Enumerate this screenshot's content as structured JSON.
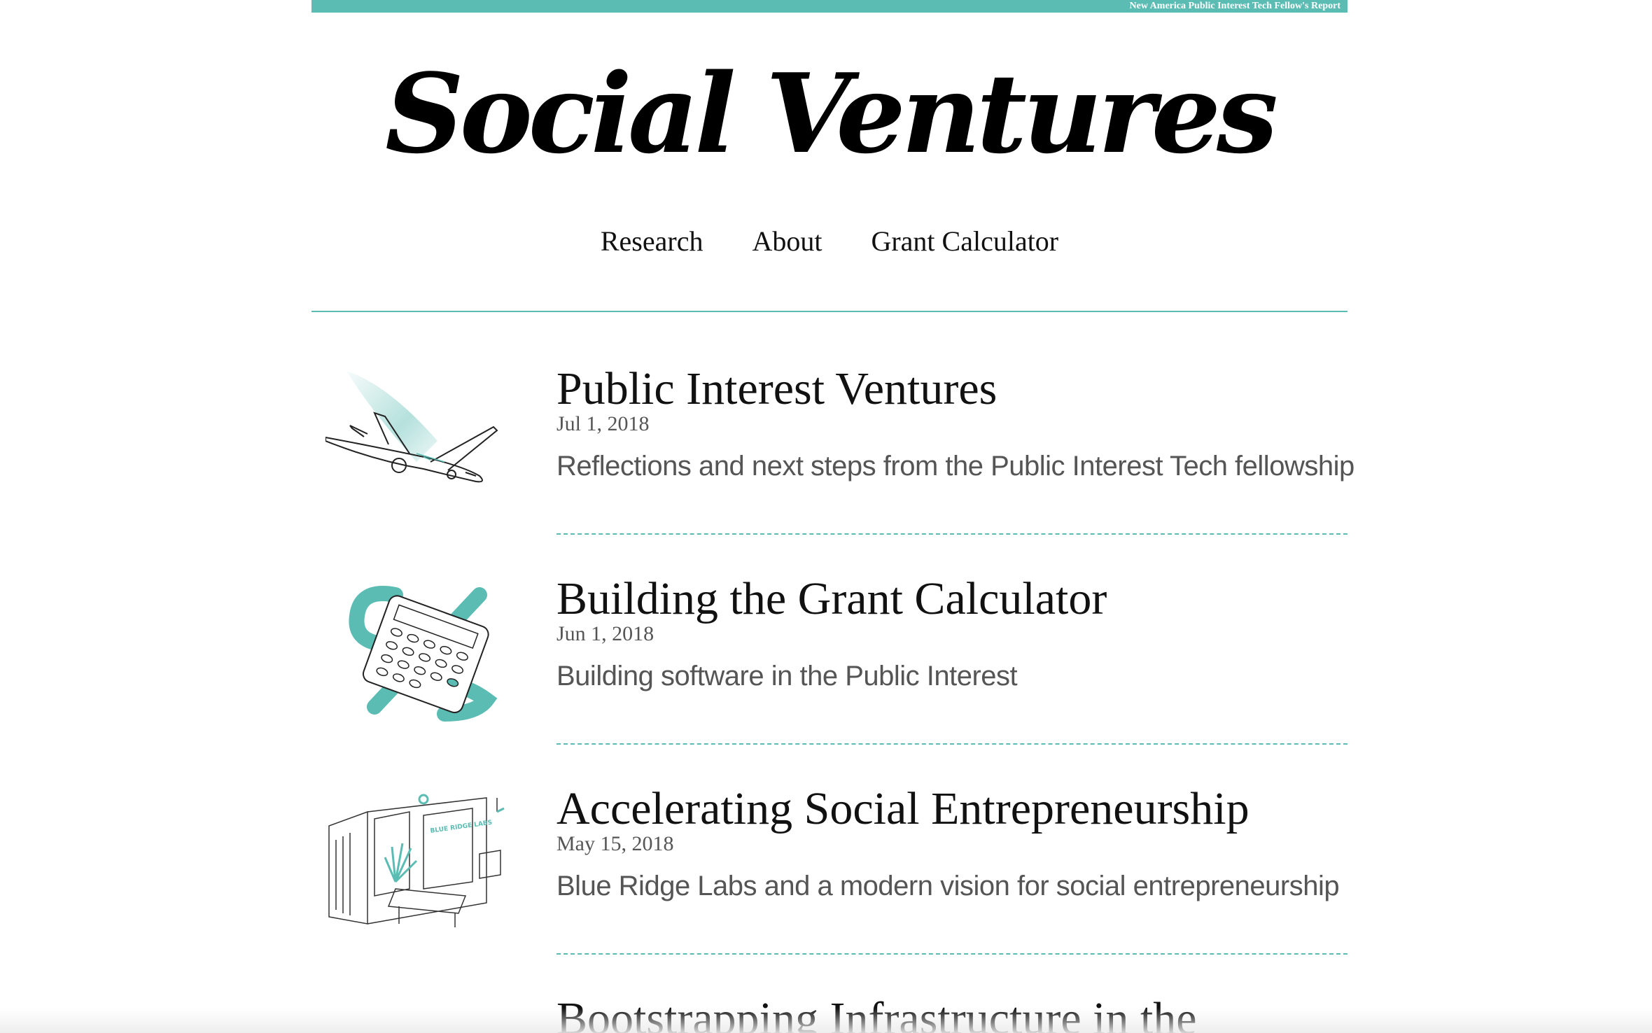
{
  "header": {
    "banner_text": "New America Public Interest Tech Fellow's Report",
    "site_title": "Social Ventures"
  },
  "nav": {
    "items": [
      {
        "label": "Research"
      },
      {
        "label": "About"
      },
      {
        "label": "Grant Calculator"
      }
    ]
  },
  "articles": [
    {
      "title": "Public Interest Ventures",
      "date": "Jul 1, 2018",
      "description": "Reflections and next steps from the Public Interest Tech fellowship",
      "thumbnail_icon": "airplane-illustration-icon"
    },
    {
      "title": "Building the Grant Calculator",
      "date": "Jun 1, 2018",
      "description": "Building software in the Public Interest",
      "thumbnail_icon": "calculator-illustration-icon"
    },
    {
      "title": "Accelerating Social Entrepreneurship",
      "date": "May 15, 2018",
      "description": "Blue Ridge Labs and a modern vision for social entrepreneurship",
      "thumbnail_icon": "office-space-illustration-icon"
    },
    {
      "title": "Bootstrapping Infrastructure in the"
    }
  ],
  "colors": {
    "accent": "#5bbcb3",
    "text": "#111111",
    "muted": "#555555"
  }
}
